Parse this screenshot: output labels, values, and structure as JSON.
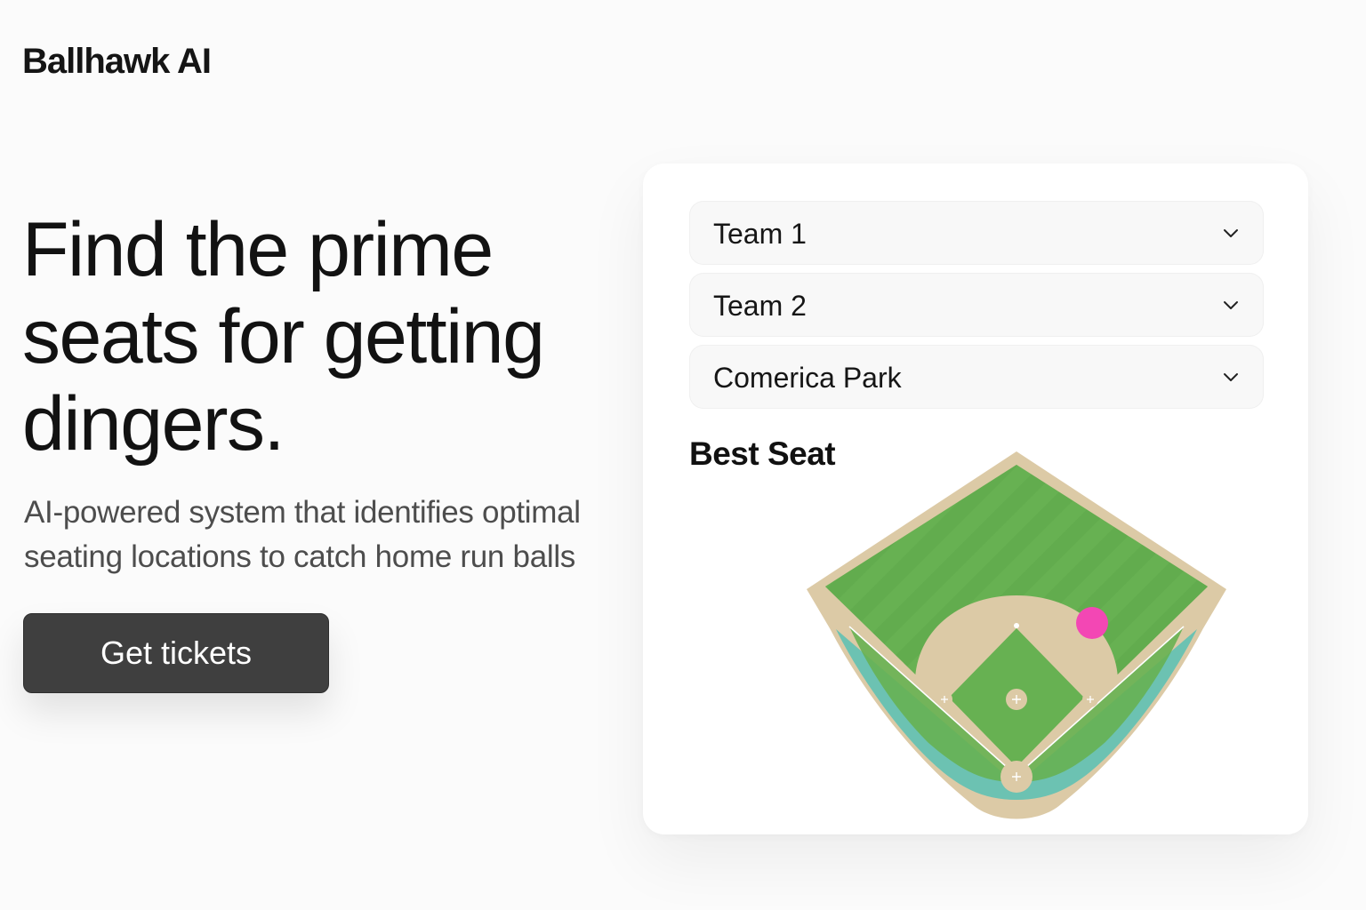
{
  "brand": {
    "name": "Ballhawk AI"
  },
  "hero": {
    "title": "Find the prime seats for getting dingers.",
    "subtitle": "AI-powered system that identifies optimal seating locations to catch home run balls",
    "cta_label": "Get tickets"
  },
  "panel": {
    "team1": {
      "value": "Team 1",
      "icon": "chevron-down-icon"
    },
    "team2": {
      "value": "Team 2",
      "icon": "chevron-down-icon"
    },
    "venue": {
      "value": "Comerica Park",
      "icon": "chevron-down-icon"
    },
    "best_seat_label": "Best Seat"
  },
  "colors": {
    "outfield_grass": "#67b152",
    "infield_dirt": "#dccaa6",
    "seating": "#6cc2b2",
    "best_seat_marker": "#f347b4",
    "cta_bg": "#3f3f3f"
  }
}
